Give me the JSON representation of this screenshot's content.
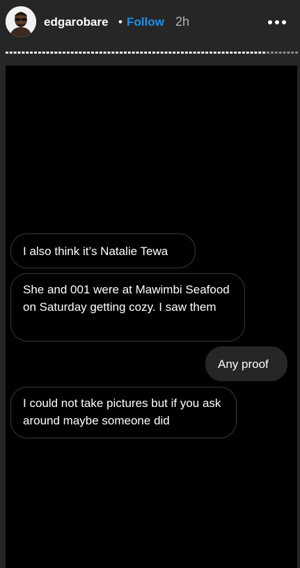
{
  "header": {
    "username": "edgarobare",
    "separator": "•",
    "follow_label": "Follow",
    "time_ago": "2h",
    "avatar_icon": "profile-avatar-icon",
    "more_icon": "more-options-icon"
  },
  "progress": {
    "segment_count": 72,
    "viewed_segments": 64,
    "viewed_color": "#ffffff",
    "unviewed_color": "#8e8e8e"
  },
  "messages": [
    {
      "sender": "other",
      "text": "I also think it’s Natalie Tewa"
    },
    {
      "sender": "other",
      "text": "She and 001 were at Mawimbi Seafood on Saturday getting cozy. I saw them"
    },
    {
      "sender": "me",
      "text": "Any proof"
    },
    {
      "sender": "other",
      "text": "I could not take pictures but if you ask around maybe someone did"
    }
  ],
  "colors": {
    "background": "#262626",
    "story_background": "#000000",
    "follow": "#1f8fe6",
    "bubble_border": "#3a3a3a",
    "my_bubble": "#262626"
  }
}
